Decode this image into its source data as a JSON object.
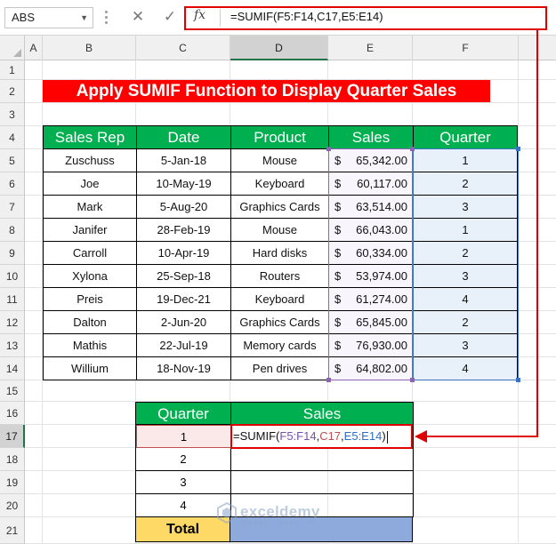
{
  "formula_bar": {
    "name_box": "ABS",
    "cancel_icon": "✕",
    "enter_icon": "✓",
    "fx_label": "fx",
    "formula": "=SUMIF(F5:F14,C17,E5:E14)"
  },
  "columns": [
    "A",
    "B",
    "C",
    "D",
    "E",
    "F"
  ],
  "rows": [
    "1",
    "2",
    "3",
    "4",
    "5",
    "6",
    "7",
    "8",
    "9",
    "10",
    "11",
    "12",
    "13",
    "14",
    "15",
    "16",
    "17",
    "18",
    "19",
    "20",
    "21"
  ],
  "title": "Apply SUMIF Function to Display Quarter Sales",
  "table": {
    "headers": [
      "Sales Rep",
      "Date",
      "Product",
      "Sales",
      "Quarter"
    ],
    "rows": [
      {
        "rep": "Zuschuss",
        "date": "5-Jan-18",
        "product": "Mouse",
        "currency": "$",
        "sales": "65,342.00",
        "quarter": "1"
      },
      {
        "rep": "Joe",
        "date": "10-May-19",
        "product": "Keyboard",
        "currency": "$",
        "sales": "60,117.00",
        "quarter": "2"
      },
      {
        "rep": "Mark",
        "date": "5-Aug-20",
        "product": "Graphics Cards",
        "currency": "$",
        "sales": "63,514.00",
        "quarter": "3"
      },
      {
        "rep": "Janifer",
        "date": "28-Feb-19",
        "product": "Mouse",
        "currency": "$",
        "sales": "66,043.00",
        "quarter": "1"
      },
      {
        "rep": "Carroll",
        "date": "10-Apr-19",
        "product": "Hard disks",
        "currency": "$",
        "sales": "60,334.00",
        "quarter": "2"
      },
      {
        "rep": "Xylona",
        "date": "25-Sep-18",
        "product": "Routers",
        "currency": "$",
        "sales": "53,974.00",
        "quarter": "3"
      },
      {
        "rep": "Preis",
        "date": "19-Dec-21",
        "product": "Keyboard",
        "currency": "$",
        "sales": "61,274.00",
        "quarter": "4"
      },
      {
        "rep": "Dalton",
        "date": "2-Jun-20",
        "product": "Graphics Cards",
        "currency": "$",
        "sales": "65,845.00",
        "quarter": "2"
      },
      {
        "rep": "Mathis",
        "date": "22-Jul-19",
        "product": "Memory cards",
        "currency": "$",
        "sales": "76,930.00",
        "quarter": "3"
      },
      {
        "rep": "Willium",
        "date": "18-Nov-19",
        "product": "Pen drives",
        "currency": "$",
        "sales": "64,802.00",
        "quarter": "4"
      }
    ]
  },
  "summary": {
    "headers": [
      "Quarter",
      "Sales"
    ],
    "quarters": [
      "1",
      "2",
      "3",
      "4"
    ],
    "editing": {
      "prefix": "=SUMIF(",
      "ref1": "F5:F14",
      "comma1": ",",
      "ref2": "C17",
      "comma2": ",",
      "ref3": "E5:E14",
      "suffix": ")"
    },
    "total_label": "Total"
  },
  "watermark": {
    "name": "exceldemy",
    "tagline": "EXCEL · DATA · BI"
  },
  "colors": {
    "title_bg": "#ff0000",
    "header_bg": "#00b050",
    "total_bg": "#ffd966",
    "total_value_bg": "#8ea9db",
    "highlight": "#e00000",
    "ref_purple": "#7b4db0",
    "ref_red": "#c0504d",
    "ref_blue": "#2e6fc4"
  }
}
